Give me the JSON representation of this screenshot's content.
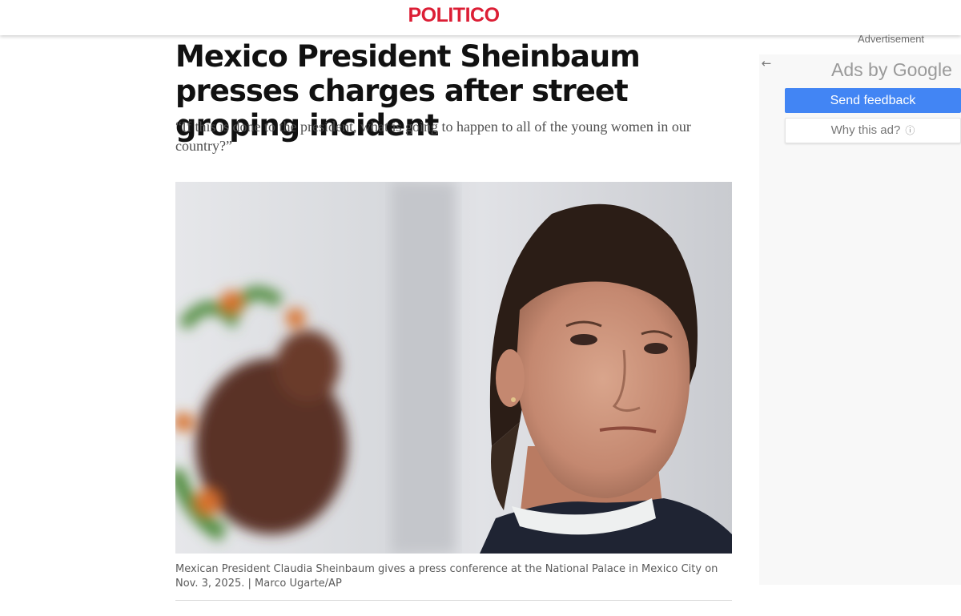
{
  "header": {
    "logo": "POLITICO"
  },
  "article": {
    "headline": "Mexico President Sheinbaum presses charges after street groping incident",
    "dek": "“If this is done to the president, what is going to happen to all of the young women in our country?”",
    "photo_caption": "Mexican President Claudia Sheinbaum gives a press conference at the National Palace in Mexico City on Nov. 3, 2025. | Marco Ugarte/AP"
  },
  "ad": {
    "label": "Advertisement",
    "back_icon": "arrow-left-icon",
    "ads_by": "Ads by Google",
    "send_feedback": "Send feedback",
    "why_this_ad": "Why this ad?",
    "info_icon": "info-icon"
  },
  "colors": {
    "brand": "#dc1e35",
    "feedback_button": "#4285f4"
  }
}
